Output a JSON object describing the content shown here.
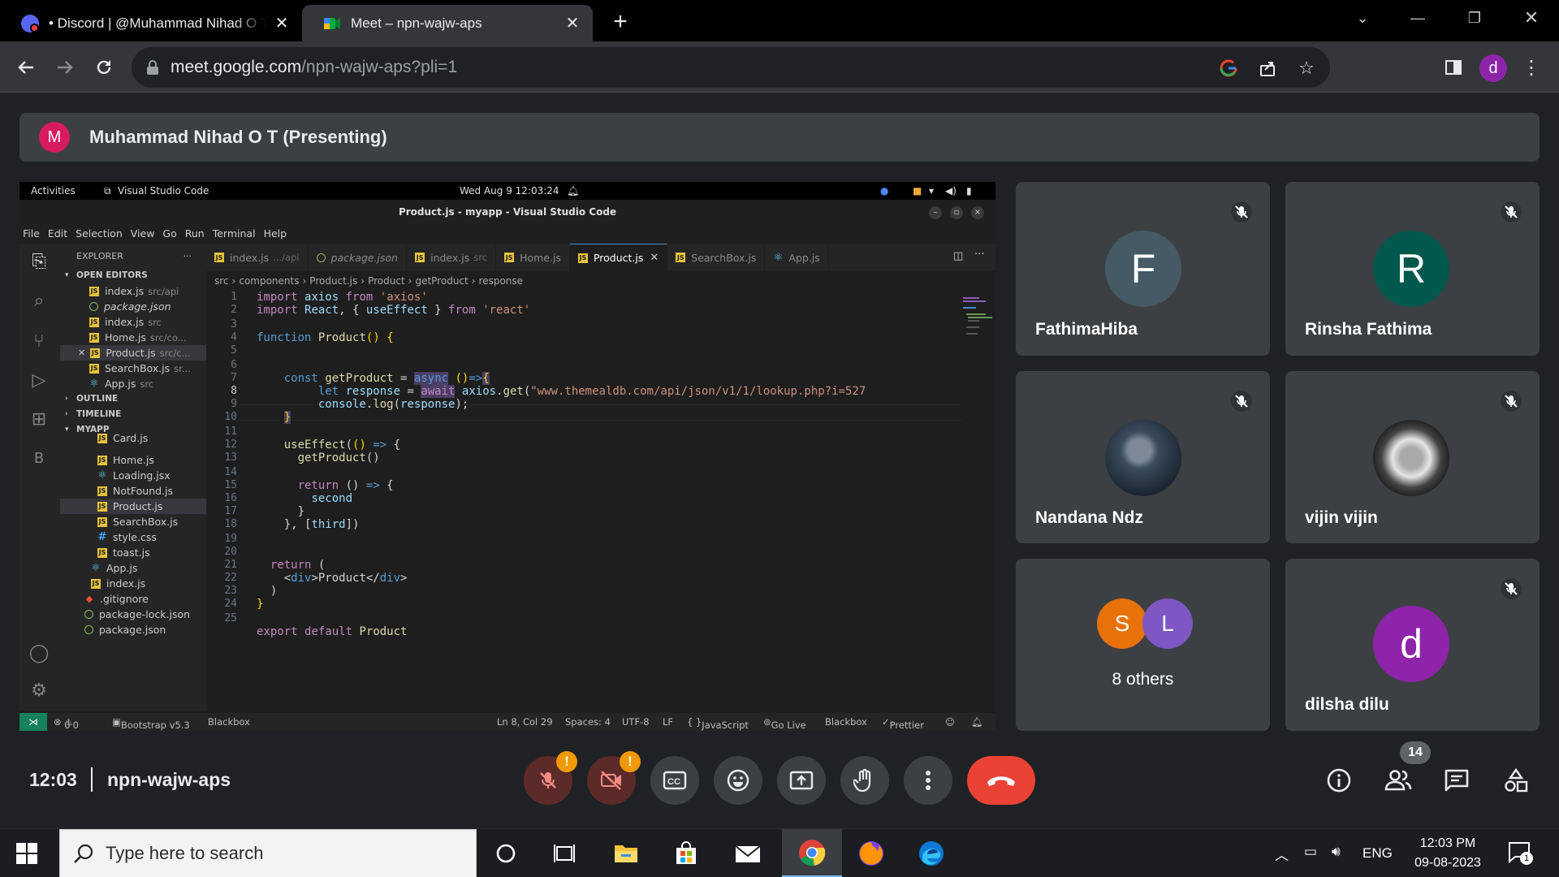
{
  "browser": {
    "tabs": [
      {
        "title": "• Discord | @Muhammad Nihad O T",
        "active": false
      },
      {
        "title": "Meet – npn-wajw-aps",
        "active": true
      }
    ],
    "url_host": "meet.google.com",
    "url_path": "/npn-wajw-aps?pli=1",
    "profile_initial": "d"
  },
  "presenting": {
    "avatar_initial": "M",
    "label": "Muhammad Nihad O T (Presenting)"
  },
  "desktop": {
    "activities": "Activities",
    "app_name": "Visual Studio Code",
    "datetime": "Wed Aug 9  12:03:24"
  },
  "vscode": {
    "window_title": "Product.js - myapp - Visual Studio Code",
    "menu": [
      "File",
      "Edit",
      "Selection",
      "View",
      "Go",
      "Run",
      "Terminal",
      "Help"
    ],
    "explorer_label": "EXPLORER",
    "sections": {
      "open_editors": "OPEN EDITORS",
      "outline": "OUTLINE",
      "timeline": "TIMELINE",
      "project": "MYAPP"
    },
    "open_editors": [
      {
        "name": "index.js",
        "sub": "src/api",
        "icon": "js"
      },
      {
        "name": "package.json",
        "sub": "",
        "icon": "json"
      },
      {
        "name": "index.js",
        "sub": "src",
        "icon": "js"
      },
      {
        "name": "Home.js",
        "sub": "src/co...",
        "icon": "js"
      },
      {
        "name": "Product.js",
        "sub": "src/c...",
        "icon": "js"
      },
      {
        "name": "SearchBox.js",
        "sub": "sr...",
        "icon": "js"
      },
      {
        "name": "App.js",
        "sub": "src",
        "icon": "react"
      }
    ],
    "project_files": [
      {
        "name": "Card.js",
        "icon": "js"
      },
      {
        "name": "Home.js",
        "icon": "js"
      },
      {
        "name": "Loading.jsx",
        "icon": "react"
      },
      {
        "name": "NotFound.js",
        "icon": "js"
      },
      {
        "name": "Product.js",
        "icon": "js"
      },
      {
        "name": "SearchBox.js",
        "icon": "js"
      },
      {
        "name": "style.css",
        "icon": "css"
      },
      {
        "name": "toast.js",
        "icon": "js"
      },
      {
        "name": "App.js",
        "icon": "react"
      },
      {
        "name": "index.js",
        "icon": "js"
      },
      {
        "name": ".gitignore",
        "icon": "git"
      },
      {
        "name": "package-lock.json",
        "icon": "json"
      },
      {
        "name": "package.json",
        "icon": "json"
      }
    ],
    "editor_tabs": [
      {
        "name": "index.js",
        "sub": ".../api"
      },
      {
        "name": "package.json",
        "sub": ""
      },
      {
        "name": "index.js",
        "sub": "src"
      },
      {
        "name": "Home.js",
        "sub": ""
      },
      {
        "name": "Product.js",
        "sub": "",
        "active": true
      },
      {
        "name": "SearchBox.js",
        "sub": ""
      },
      {
        "name": "App.js",
        "sub": ""
      }
    ],
    "breadcrumb": [
      "src",
      "components",
      "Product.js",
      "Product",
      "getProduct",
      "response"
    ],
    "current_line": 8,
    "status": {
      "problems": "0",
      "warnings": "0",
      "bootstrap": "Bootstrap v5.3",
      "blackbox_left": "Blackbox",
      "position": "Ln 8, Col 29",
      "spaces": "Spaces: 4",
      "encoding": "UTF-8",
      "eol": "LF",
      "language": "JavaScript",
      "golive": "Go Live",
      "blackbox_right": "Blackbox",
      "prettier": "Prettier"
    }
  },
  "participants": [
    {
      "name": "FathimaHiba",
      "initial": "F",
      "color": "#455a64"
    },
    {
      "name": "Rinsha Fathima",
      "initial": "R",
      "color": "#00594c"
    },
    {
      "name": "Nandana Ndz",
      "initial": "",
      "color": "#2b3a4a"
    },
    {
      "name": "vijin vijin",
      "initial": "",
      "color": "#d8d8d8"
    },
    {
      "name": "dilsha dilu",
      "initial": "d",
      "color": "#8e24aa"
    }
  ],
  "others": {
    "label": "8 others",
    "avatars": [
      {
        "initial": "S",
        "color": "#e8710a"
      },
      {
        "initial": "L",
        "color": "#7e57c2"
      }
    ]
  },
  "meeting": {
    "time": "12:03",
    "code": "npn-wajw-aps",
    "people_count": "14"
  },
  "taskbar": {
    "search_placeholder": "Type here to search",
    "language": "ENG",
    "time": "12:03 PM",
    "date": "09-08-2023",
    "notification_count": "1"
  }
}
